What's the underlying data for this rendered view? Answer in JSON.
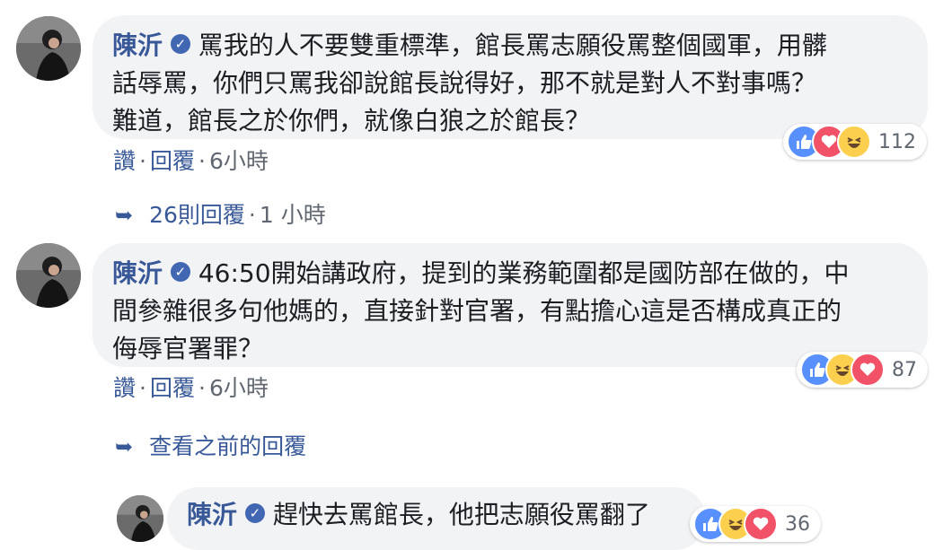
{
  "comments": [
    {
      "author": "陳沂",
      "verified_icon": "check-icon",
      "text_lines": [
        "罵我的人不要雙重標準，館長罵志願役罵整個國軍，用髒",
        "話辱罵，你們只罵我卻說館長說得好，那不就是對人不對事嗎？",
        "難道，館長之於你們，就像白狼之於館長？"
      ],
      "reaction_icons": [
        "like",
        "love",
        "haha"
      ],
      "reaction_count": "112",
      "like_label": "讚",
      "reply_label": "回覆",
      "time": "6小時"
    },
    {
      "author": "陳沂",
      "verified_icon": "check-icon",
      "text_lines": [
        "46:50開始講政府，提到的業務範圍都是國防部在做的，中",
        "間參雜很多句他媽的，直接針對官署，有點擔心這是否構成真正的",
        "侮辱官署罪？"
      ],
      "reaction_icons": [
        "like",
        "haha",
        "love"
      ],
      "reaction_count": "87",
      "like_label": "讚",
      "reply_label": "回覆",
      "time": "6小時"
    },
    {
      "author": "陳沂",
      "verified_icon": "check-icon",
      "text_lines": [
        "趕快去罵館長，他把志願役罵翻了"
      ],
      "reaction_icons": [
        "like",
        "haha",
        "love"
      ],
      "reaction_count": "36"
    }
  ],
  "reply_link": {
    "label": "26則回覆",
    "separator": "·",
    "time": "1 小時"
  },
  "view_previous": {
    "label": "查看之前的回覆"
  },
  "action_separator": "·",
  "colors": {
    "link": "#385898",
    "bubble": "#f2f3f5",
    "like": "#5890ff",
    "love": "#f25268",
    "haha": "#fcd04e"
  }
}
